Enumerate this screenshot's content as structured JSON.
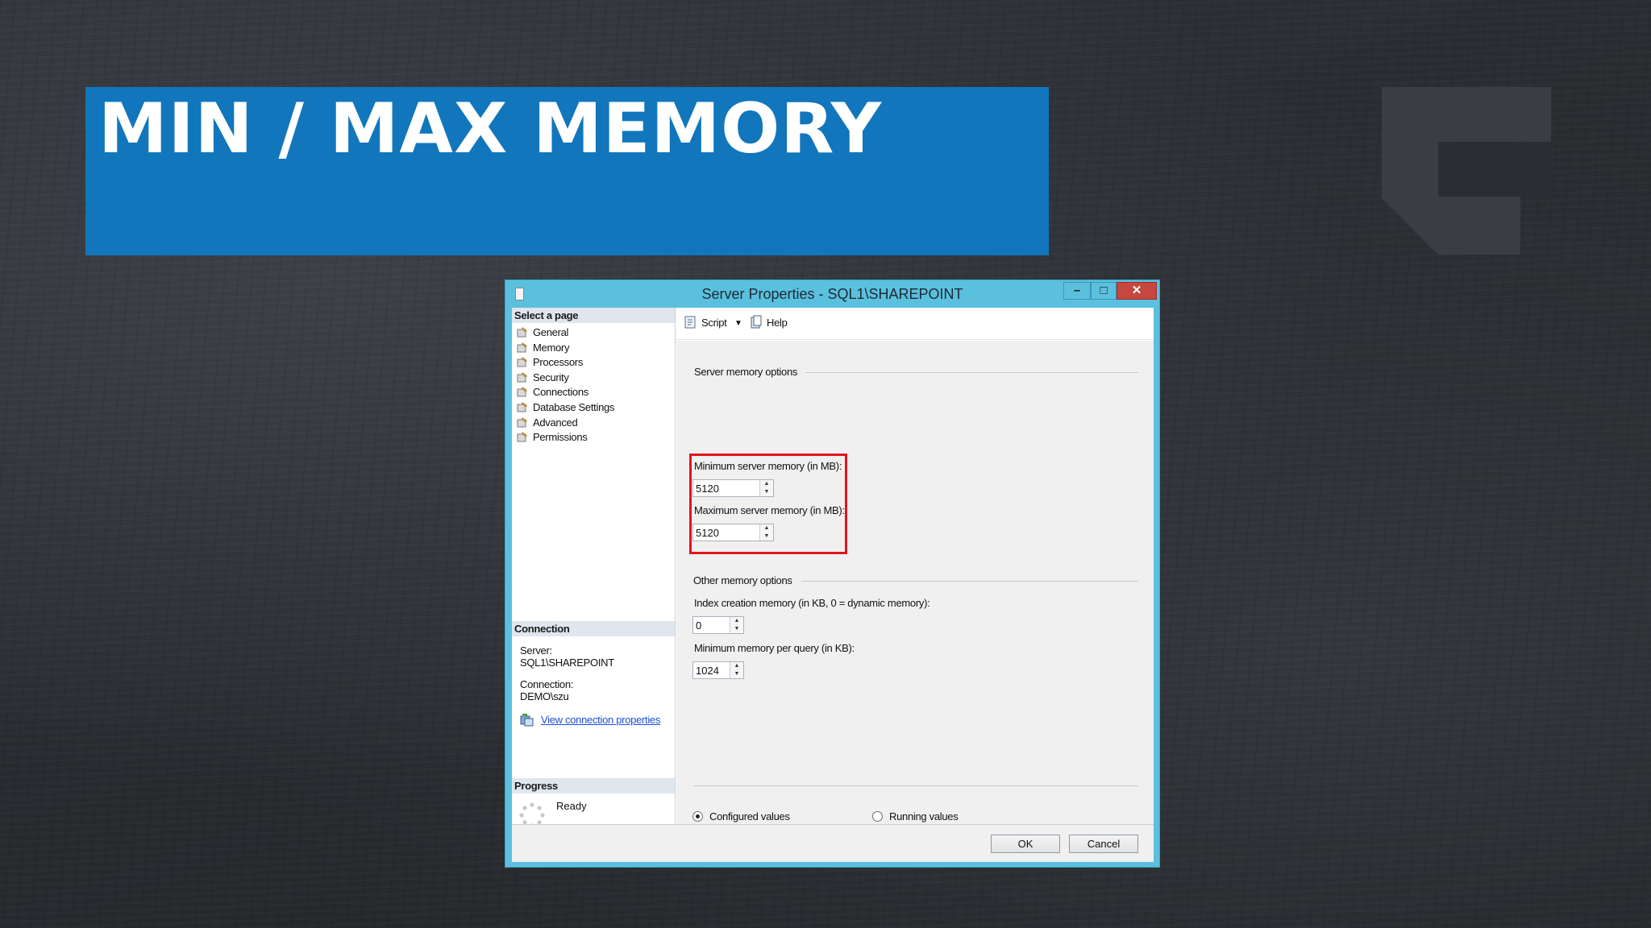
{
  "slide": {
    "title": "MIN / MAX MEMORY"
  },
  "window": {
    "title": "Server Properties - SQL1\\SHAREPOINT",
    "title_bar_color": "#5bc0de",
    "close_button_color": "#c7463d"
  },
  "left_pane": {
    "select_page_header": "Select a page",
    "pages": [
      {
        "label": "General",
        "icon": "wrench-icon"
      },
      {
        "label": "Memory",
        "icon": "wrench-icon"
      },
      {
        "label": "Processors",
        "icon": "wrench-icon"
      },
      {
        "label": "Security",
        "icon": "wrench-icon"
      },
      {
        "label": "Connections",
        "icon": "wrench-icon"
      },
      {
        "label": "Database Settings",
        "icon": "wrench-icon"
      },
      {
        "label": "Advanced",
        "icon": "wrench-icon"
      },
      {
        "label": "Permissions",
        "icon": "wrench-icon"
      }
    ],
    "connection_header": "Connection",
    "server_label": "Server:",
    "server_value": "SQL1\\SHAREPOINT",
    "connection_label": "Connection:",
    "connection_value": "DEMO\\szu",
    "view_connection_link": "View connection properties",
    "progress_header": "Progress",
    "progress_status": "Ready"
  },
  "toolbar": {
    "script_label": "Script",
    "help_label": "Help"
  },
  "memory": {
    "server_memory_group": "Server memory options",
    "min_label": "Minimum server memory (in MB):",
    "min_value": "5120",
    "max_label": "Maximum server memory (in MB):",
    "max_value": "5120",
    "other_memory_group": "Other memory options",
    "index_label": "Index creation memory (in KB, 0 = dynamic memory):",
    "index_value": "0",
    "query_label": "Minimum memory per query (in KB):",
    "query_value": "1024",
    "highlight_color": "#e1141c"
  },
  "radios": {
    "configured_label": "Configured values",
    "configured_selected": true,
    "running_label": "Running values",
    "running_selected": false
  },
  "buttons": {
    "ok_label": "OK",
    "cancel_label": "Cancel"
  },
  "colors": {
    "banner": "#1176bc",
    "link": "#1a4fd6"
  }
}
